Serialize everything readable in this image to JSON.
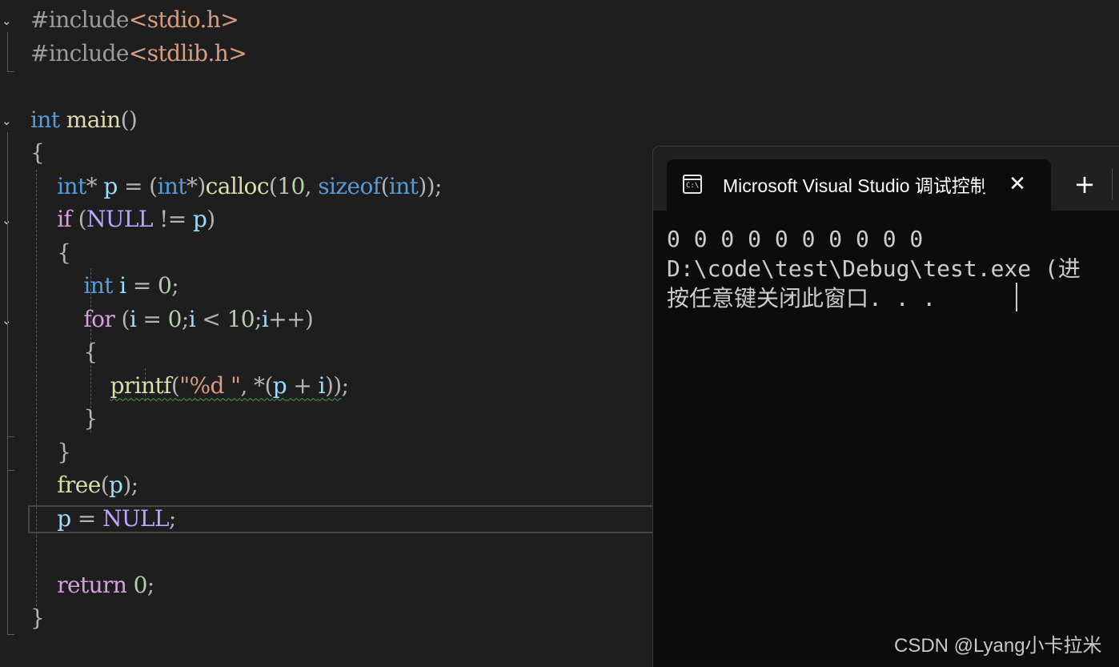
{
  "editor": {
    "lines": [
      [
        {
          "t": "#include",
          "c": "inc"
        },
        {
          "t": "<stdio.h>",
          "c": "str"
        }
      ],
      [
        {
          "t": "#include",
          "c": "inc"
        },
        {
          "t": "<stdlib.h>",
          "c": "str"
        }
      ],
      [],
      [
        {
          "t": "int",
          "c": "kw"
        },
        {
          "t": " "
        },
        {
          "t": "main",
          "c": "fn"
        },
        {
          "t": "()",
          "c": "op"
        }
      ],
      [
        {
          "t": "{",
          "c": "op"
        }
      ],
      [
        {
          "t": "    "
        },
        {
          "t": "int",
          "c": "kw"
        },
        {
          "t": "* ",
          "c": "op"
        },
        {
          "t": "p",
          "c": "var"
        },
        {
          "t": " = (",
          "c": "op"
        },
        {
          "t": "int",
          "c": "kw"
        },
        {
          "t": "*)",
          "c": "op"
        },
        {
          "t": "calloc",
          "c": "fn"
        },
        {
          "t": "(",
          "c": "op"
        },
        {
          "t": "10",
          "c": "num"
        },
        {
          "t": ", ",
          "c": "op"
        },
        {
          "t": "sizeof",
          "c": "kw"
        },
        {
          "t": "(",
          "c": "op"
        },
        {
          "t": "int",
          "c": "kw"
        },
        {
          "t": "));",
          "c": "op"
        }
      ],
      [
        {
          "t": "    "
        },
        {
          "t": "if",
          "c": "ctl"
        },
        {
          "t": " (",
          "c": "op"
        },
        {
          "t": "NULL",
          "c": "mac"
        },
        {
          "t": " != ",
          "c": "op"
        },
        {
          "t": "p",
          "c": "var"
        },
        {
          "t": ")",
          "c": "op"
        }
      ],
      [
        {
          "t": "    "
        },
        {
          "t": "{",
          "c": "op"
        }
      ],
      [
        {
          "t": "        "
        },
        {
          "t": "int",
          "c": "kw"
        },
        {
          "t": " "
        },
        {
          "t": "i",
          "c": "var"
        },
        {
          "t": " = ",
          "c": "op"
        },
        {
          "t": "0",
          "c": "num"
        },
        {
          "t": ";",
          "c": "op"
        }
      ],
      [
        {
          "t": "        "
        },
        {
          "t": "for",
          "c": "ctl"
        },
        {
          "t": " (",
          "c": "op"
        },
        {
          "t": "i",
          "c": "var"
        },
        {
          "t": " = ",
          "c": "op"
        },
        {
          "t": "0",
          "c": "num"
        },
        {
          "t": ";",
          "c": "op"
        },
        {
          "t": "i",
          "c": "var"
        },
        {
          "t": " < ",
          "c": "op"
        },
        {
          "t": "10",
          "c": "num"
        },
        {
          "t": ";",
          "c": "op"
        },
        {
          "t": "i",
          "c": "var"
        },
        {
          "t": "++)",
          "c": "op"
        }
      ],
      [
        {
          "t": "        "
        },
        {
          "t": "{",
          "c": "op"
        }
      ],
      [
        {
          "t": "            "
        },
        {
          "t": "printf",
          "c": "fn squig"
        },
        {
          "t": "(",
          "c": "op squig"
        },
        {
          "t": "\"%d \"",
          "c": "str squig"
        },
        {
          "t": ", *(",
          "c": "op squig"
        },
        {
          "t": "p",
          "c": "var squig"
        },
        {
          "t": " + ",
          "c": "op squig"
        },
        {
          "t": "i",
          "c": "var squig"
        },
        {
          "t": "))",
          "c": "op squig"
        },
        {
          "t": ";",
          "c": "op"
        }
      ],
      [
        {
          "t": "        "
        },
        {
          "t": "}",
          "c": "op"
        }
      ],
      [
        {
          "t": "    "
        },
        {
          "t": "}",
          "c": "op"
        }
      ],
      [
        {
          "t": "    "
        },
        {
          "t": "free",
          "c": "fn"
        },
        {
          "t": "(",
          "c": "op"
        },
        {
          "t": "p",
          "c": "var"
        },
        {
          "t": ");",
          "c": "op"
        }
      ],
      [
        {
          "t": "    "
        },
        {
          "t": "p",
          "c": "var"
        },
        {
          "t": " = ",
          "c": "op"
        },
        {
          "t": "NULL",
          "c": "mac"
        },
        {
          "t": ";",
          "c": "op"
        }
      ],
      [],
      [
        {
          "t": "    "
        },
        {
          "t": "return",
          "c": "ctl"
        },
        {
          "t": " "
        },
        {
          "t": "0",
          "c": "num"
        },
        {
          "t": ";",
          "c": "op"
        }
      ],
      [
        {
          "t": "}",
          "c": "op"
        }
      ]
    ]
  },
  "console": {
    "tab_title": "Microsoft Visual Studio 调试控制台",
    "tab_icon_text": "C:\\",
    "close_glyph": "✕",
    "new_tab_glyph": "+",
    "output_lines": [
      "0 0 0 0 0 0 0 0 0 0",
      "D:\\code\\test\\Debug\\test.exe (进",
      "按任意键关闭此窗口. . ."
    ]
  },
  "watermark": "CSDN @Lyang小卡拉米"
}
